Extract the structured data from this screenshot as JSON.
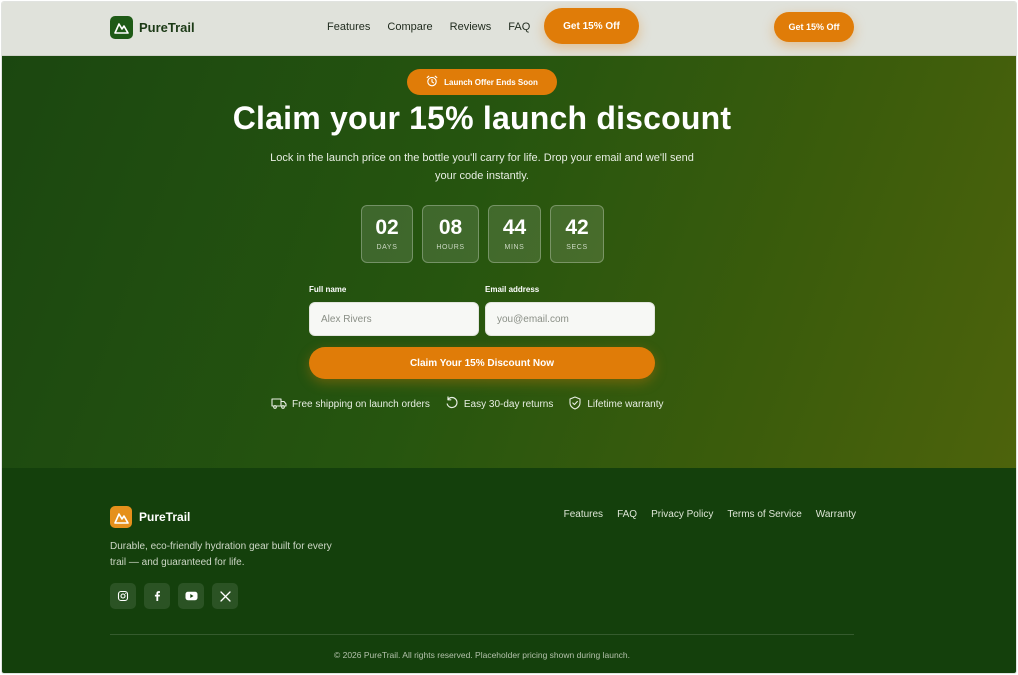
{
  "nav": {
    "brand": "PureTrail",
    "links": [
      "Features",
      "Compare",
      "Reviews",
      "FAQ"
    ],
    "cta_primary": "Get 15% Off",
    "cta_secondary": "Get 15% Off"
  },
  "hero": {
    "badge": "Launch Offer Ends Soon",
    "title": "Claim your 15% launch discount",
    "subtitle": "Lock in the launch price on the bottle you'll carry for life. Drop your email and we'll send your code instantly.",
    "countdown": [
      {
        "value": "02",
        "label": "DAYS"
      },
      {
        "value": "08",
        "label": "HOURS"
      },
      {
        "value": "44",
        "label": "MINS"
      },
      {
        "value": "42",
        "label": "SECS"
      }
    ],
    "form": {
      "name_label": "Full name",
      "name_placeholder": "Alex Rivers",
      "email_label": "Email address",
      "email_placeholder": "you@email.com",
      "submit_label": "Claim Your 15% Discount Now"
    },
    "trust": [
      {
        "icon": "truck-icon",
        "text": "Free shipping on launch orders"
      },
      {
        "icon": "refresh-icon",
        "text": "Easy 30-day returns"
      },
      {
        "icon": "shield-check-icon",
        "text": "Lifetime warranty"
      }
    ]
  },
  "footer": {
    "brand": "PureTrail",
    "tagline": "Durable, eco-friendly hydration gear built for every trail — and guaranteed for life.",
    "social": [
      "instagram-icon",
      "facebook-icon",
      "youtube-icon",
      "x-icon"
    ],
    "links": [
      "Features",
      "FAQ",
      "Privacy Policy",
      "Terms of Service",
      "Warranty"
    ],
    "copyright": "© 2026 PureTrail. All rights reserved. Placeholder pricing shown during launch."
  },
  "colors": {
    "accent": "#e07c08",
    "hero_green": "#1b4710",
    "footer_green": "#14400c",
    "nav_bg": "#e0e2db"
  }
}
